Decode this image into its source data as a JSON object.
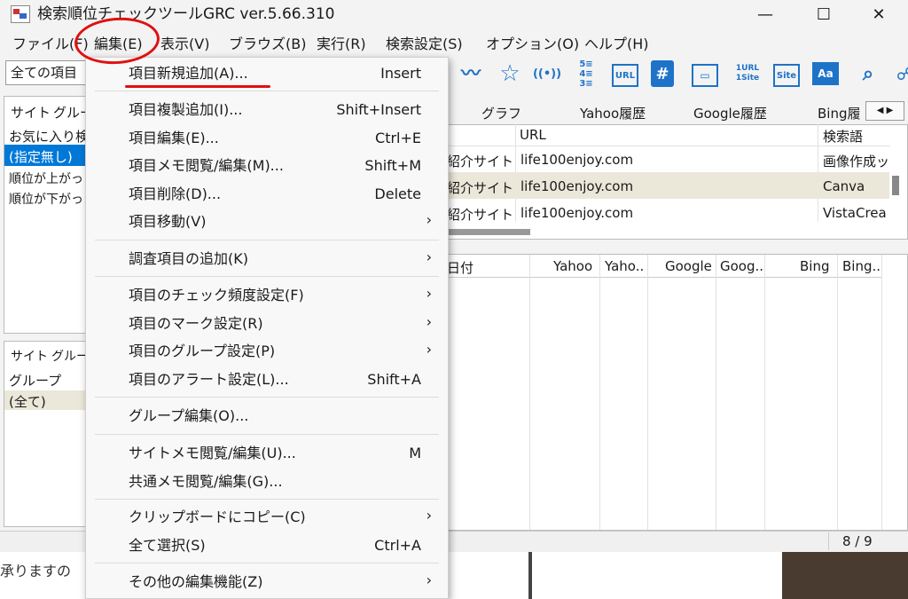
{
  "window": {
    "title": "検索順位チェックツールGRC  ver.5.66.310",
    "minimize": "—",
    "maximize": "☐",
    "close": "✕"
  },
  "menubar": [
    "ファイル(F)",
    "編集(E)",
    "表示(V)",
    "ブラウズ(B)",
    "実行(R)",
    "検索設定(S)",
    "オプション(O)",
    "ヘルプ(H)"
  ],
  "toolbar": {
    "item_filter": "全ての項目"
  },
  "left_pane": {
    "tabs": [
      "サイト",
      "グルー"
    ],
    "items": [
      "お気に入り検索",
      "(指定無し)",
      "順位が上がっ",
      "順位が下がっ"
    ],
    "bottom_tabs": [
      "サイト",
      "グルー"
    ],
    "group_header": "グループ",
    "group_items": [
      "(全て)"
    ]
  },
  "right_tabs": [
    "グラフ",
    "Yahoo履歴",
    "Google履歴",
    "Bing履"
  ],
  "table": {
    "headers": [
      "URL",
      "検索語"
    ],
    "rows": [
      {
        "category": "紹介サイト",
        "url": "life100enjoy.com",
        "keyword": "画像作成ッ"
      },
      {
        "category": "紹介サイト",
        "url": "life100enjoy.com",
        "keyword": "Canva"
      },
      {
        "category": "紹介サイト",
        "url": "life100enjoy.com",
        "keyword": "VistaCrea"
      }
    ]
  },
  "history": {
    "headers": [
      "日付",
      "Yahoo",
      "Yaho..",
      "Google",
      "Goog..",
      "Bing",
      "Bing.."
    ]
  },
  "status": {
    "count": "8 / 9"
  },
  "background_text": "承りますの",
  "context_menu": {
    "items": [
      {
        "label": "項目新規追加(A)...",
        "shortcut": "Insert",
        "arrow": ""
      },
      {
        "label": "項目複製追加(I)...",
        "shortcut": "Shift+Insert",
        "arrow": ""
      },
      {
        "label": "項目編集(E)...",
        "shortcut": "Ctrl+E",
        "arrow": ""
      },
      {
        "label": "項目メモ閲覧/編集(M)...",
        "shortcut": "Shift+M",
        "arrow": ""
      },
      {
        "label": "項目削除(D)...",
        "shortcut": "Delete",
        "arrow": ""
      },
      {
        "label": "項目移動(V)",
        "shortcut": "",
        "arrow": "›"
      },
      {
        "label": "調査項目の追加(K)",
        "shortcut": "",
        "arrow": "›"
      },
      {
        "label": "項目のチェック頻度設定(F)",
        "shortcut": "",
        "arrow": "›"
      },
      {
        "label": "項目のマーク設定(R)",
        "shortcut": "",
        "arrow": "›"
      },
      {
        "label": "項目のグループ設定(P)",
        "shortcut": "",
        "arrow": "›"
      },
      {
        "label": "項目のアラート設定(L)...",
        "shortcut": "Shift+A",
        "arrow": ""
      },
      {
        "label": "グループ編集(O)...",
        "shortcut": "",
        "arrow": ""
      },
      {
        "label": "サイトメモ閲覧/編集(U)...",
        "shortcut": "M",
        "arrow": ""
      },
      {
        "label": "共通メモ閲覧/編集(G)...",
        "shortcut": "",
        "arrow": ""
      },
      {
        "label": "クリップボードにコピー(C)",
        "shortcut": "",
        "arrow": "›"
      },
      {
        "label": "全て選択(S)",
        "shortcut": "Ctrl+A",
        "arrow": ""
      },
      {
        "label": "その他の編集機能(Z)",
        "shortcut": "",
        "arrow": "›"
      }
    ]
  },
  "toolbar_icons": [
    {
      "name": "graph-line-icon",
      "glyph": "〰"
    },
    {
      "name": "star-icon",
      "glyph": "☆"
    },
    {
      "name": "broadcast-icon",
      "glyph": "((•))"
    },
    {
      "name": "rank-list-icon",
      "glyph": "5\n4\n3"
    },
    {
      "name": "url-icon",
      "glyph": "URL"
    },
    {
      "name": "hash-tag-icon",
      "glyph": "#"
    },
    {
      "name": "window-icon",
      "glyph": "▭"
    },
    {
      "name": "1url-1site-icon",
      "glyph": "1URL\n1Site"
    },
    {
      "name": "site-icon",
      "glyph": "Site"
    },
    {
      "name": "font-icon",
      "glyph": "Aa"
    },
    {
      "name": "search-icon",
      "glyph": "🔍"
    }
  ],
  "colors": {
    "accent_blue": "#1e73c8",
    "selection_blue": "#0078d7",
    "annotation_red": "#e01010",
    "selected_row": "#ebe7d9"
  }
}
